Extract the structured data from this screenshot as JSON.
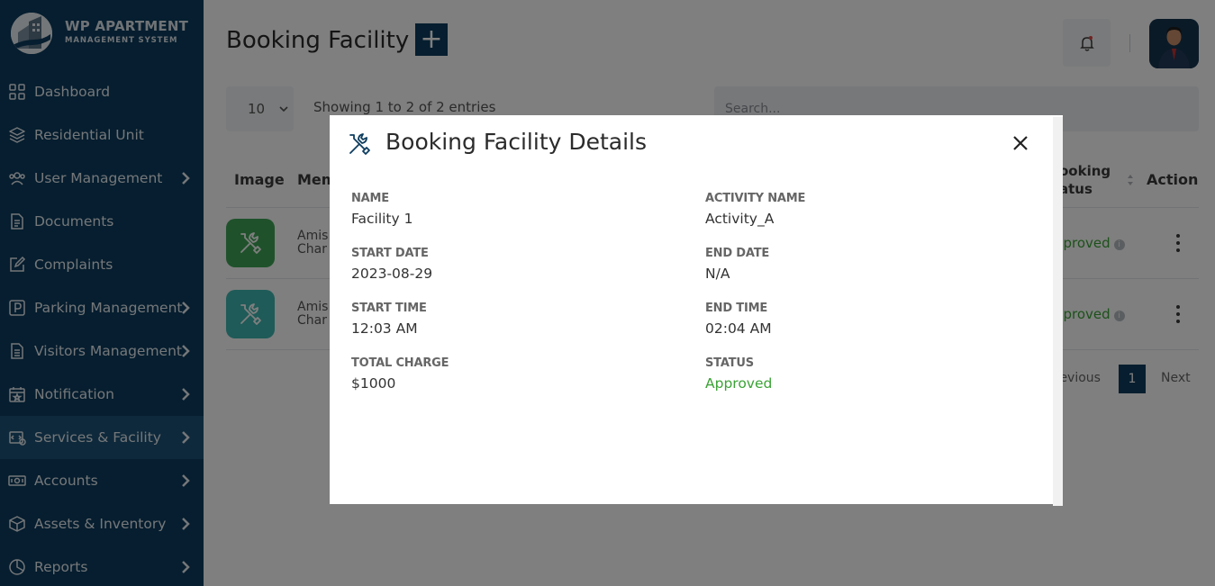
{
  "brand": {
    "title": "WP APARTMENT",
    "subtitle": "MANAGEMENT SYSTEM"
  },
  "sidebar": {
    "items": [
      {
        "label": "Dashboard",
        "icon": "grid-icon",
        "has_chevron": false
      },
      {
        "label": "Residential Unit",
        "icon": "layers-icon",
        "has_chevron": false
      },
      {
        "label": "User Management",
        "icon": "users-icon",
        "has_chevron": true
      },
      {
        "label": "Documents",
        "icon": "document-icon",
        "has_chevron": false
      },
      {
        "label": "Complaints",
        "icon": "edit-icon",
        "has_chevron": false
      },
      {
        "label": "Parking Management",
        "icon": "parking-icon",
        "has_chevron": true
      },
      {
        "label": "Visitors Management",
        "icon": "document-list-icon",
        "has_chevron": true
      },
      {
        "label": "Notification",
        "icon": "calendar-star-icon",
        "has_chevron": true
      },
      {
        "label": "Services & Facility",
        "icon": "services-icon",
        "has_chevron": true,
        "active": true
      },
      {
        "label": "Accounts",
        "icon": "money-icon",
        "has_chevron": true
      },
      {
        "label": "Assets & Inventory",
        "icon": "box-icon",
        "has_chevron": true
      },
      {
        "label": "Reports",
        "icon": "pie-chart-icon",
        "has_chevron": true
      }
    ]
  },
  "header": {
    "title": "Booking Facility",
    "add_label": "+"
  },
  "table_controls": {
    "page_length": "10",
    "showing": "Showing 1 to 2 of 2 entries",
    "search_placeholder": "Search..."
  },
  "table": {
    "columns": {
      "image": "Image",
      "member": "Mem",
      "booking_status_1": "ooking",
      "booking_status_2": "atus",
      "action": "Action"
    },
    "rows": [
      {
        "member_1": "Amis",
        "member_2": "Char",
        "status": "pproved",
        "thumb_color": "#3fa556"
      },
      {
        "member_1": "Amis",
        "member_2": "Char",
        "status": "pproved",
        "thumb_color": "#3eb6b0"
      }
    ],
    "pagination": {
      "prev": "revious",
      "current": "1",
      "next": "Next"
    }
  },
  "modal": {
    "title": "Booking Facility Details",
    "fields": {
      "name_label": "NAME",
      "name_value": "Facility 1",
      "activity_label": "ACTIVITY NAME",
      "activity_value": "Activity_A",
      "start_date_label": "START DATE",
      "start_date_value": "2023-08-29",
      "end_date_label": "END DATE",
      "end_date_value": "N/A",
      "start_time_label": "START TIME",
      "start_time_value": "12:03 AM",
      "end_time_label": "END TIME",
      "end_time_value": "02:04 AM",
      "total_charge_label": "TOTAL CHARGE",
      "total_charge_value": "$1000",
      "status_label": "STATUS",
      "status_value": "Approved"
    }
  },
  "colors": {
    "sidebar": "#0d3c5e",
    "accent": "#0d3c5e",
    "approved": "#3aa335"
  }
}
